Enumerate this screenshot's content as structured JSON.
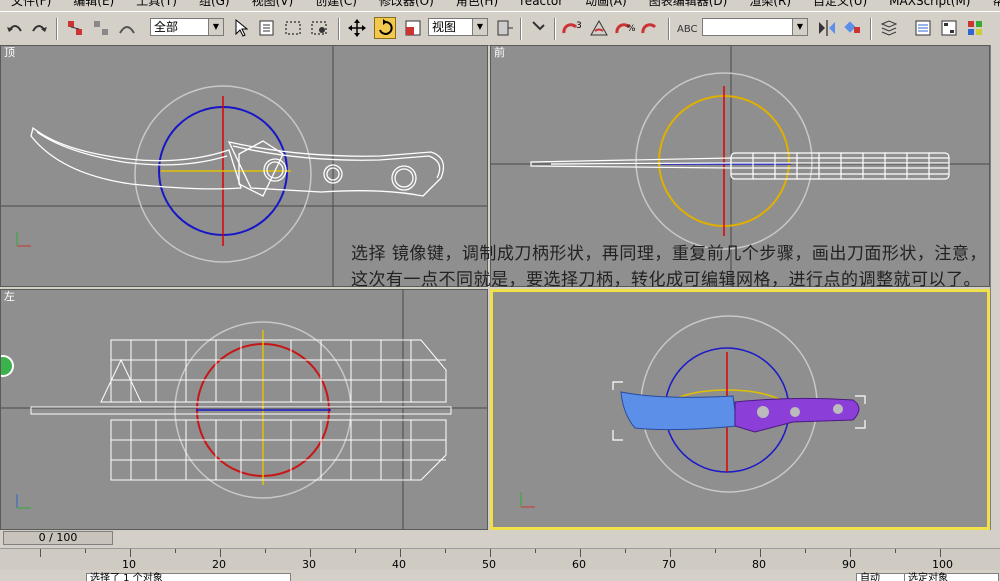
{
  "menu": [
    "文件(F)",
    "编辑(E)",
    "工具(T)",
    "组(G)",
    "视图(V)",
    "创建(C)",
    "修改器(O)",
    "角色(H)",
    "reactor",
    "动画(A)",
    "图表编辑器(D)",
    "渲染(R)",
    "自定义(U)",
    "MAXScript(M)",
    "帮助(H)"
  ],
  "toolbar": {
    "selection_filter": "全部",
    "reference_coord": "视图",
    "named_selection": ""
  },
  "viewports": {
    "top": "顶",
    "front": "前",
    "left": "左",
    "perspective": ""
  },
  "overlay_text": "选择 镜像键，调制成刀柄形状，再同理，重复前几个步骤，画出刀面形状，注意，这次有一点不同就是，要选择刀柄，转化成可编辑网格，进行点的调整就可以了。",
  "timeline": {
    "frame_display": "0 / 100",
    "ruler_labels": [
      "10",
      "20",
      "30",
      "40",
      "50",
      "60",
      "70",
      "80",
      "90",
      "100"
    ]
  },
  "status": {
    "selection": "选择了 1 个对象",
    "auto_key": "自动",
    "set_key": "选定对象"
  },
  "colors": {
    "viewport_bg": "#8f8f8f",
    "active_border": "#f0e04a",
    "blade_blue": "#5b8fe8",
    "handle_purple": "#8c3fd8"
  }
}
